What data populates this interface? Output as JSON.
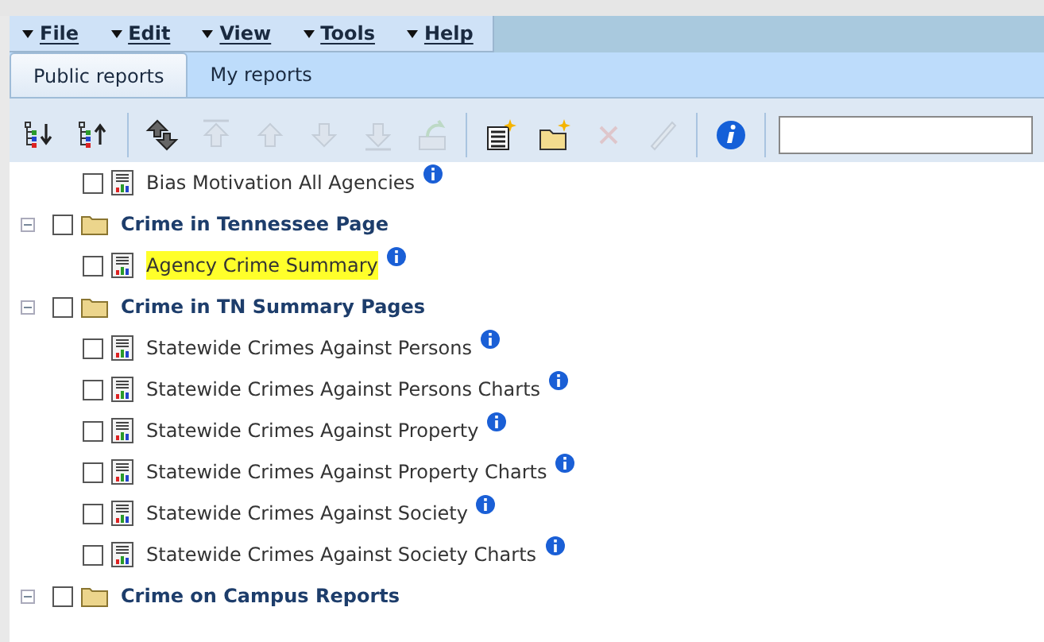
{
  "menu": [
    {
      "label": "File"
    },
    {
      "label": "Edit"
    },
    {
      "label": "View"
    },
    {
      "label": "Tools"
    },
    {
      "label": "Help"
    }
  ],
  "tabs": [
    {
      "label": "Public reports",
      "selected": true
    },
    {
      "label": "My reports",
      "selected": false
    }
  ],
  "toolbar": [
    {
      "kind": "expand-all",
      "disabled": false
    },
    {
      "kind": "collapse-all",
      "disabled": false
    },
    {
      "kind": "sep"
    },
    {
      "kind": "move",
      "disabled": false
    },
    {
      "kind": "top",
      "disabled": true
    },
    {
      "kind": "up",
      "disabled": true
    },
    {
      "kind": "down",
      "disabled": true
    },
    {
      "kind": "bottom",
      "disabled": true
    },
    {
      "kind": "export",
      "disabled": true
    },
    {
      "kind": "sep"
    },
    {
      "kind": "new-report",
      "disabled": false
    },
    {
      "kind": "new-folder",
      "disabled": false
    },
    {
      "kind": "delete",
      "disabled": true
    },
    {
      "kind": "edit",
      "disabled": true
    },
    {
      "kind": "sep"
    },
    {
      "kind": "info",
      "disabled": false
    },
    {
      "kind": "sep"
    }
  ],
  "tree": [
    {
      "label": "Bias Motivation All Agencies",
      "kind": "report",
      "checked": false,
      "highlighted": false
    },
    {
      "label": "Crime in Tennessee Page",
      "kind": "folder",
      "checked": false,
      "expanded": true,
      "children": [
        {
          "label": "Agency Crime Summary",
          "kind": "report",
          "checked": false,
          "highlighted": true
        }
      ]
    },
    {
      "label": "Crime in TN Summary Pages",
      "kind": "folder",
      "checked": false,
      "expanded": true,
      "children": [
        {
          "label": "Statewide Crimes Against Persons",
          "kind": "report",
          "checked": false,
          "highlighted": false
        },
        {
          "label": "Statewide Crimes Against Persons Charts",
          "kind": "report",
          "checked": false,
          "highlighted": false
        },
        {
          "label": "Statewide Crimes Against Property",
          "kind": "report",
          "checked": false,
          "highlighted": false
        },
        {
          "label": "Statewide Crimes Against Property Charts",
          "kind": "report",
          "checked": false,
          "highlighted": false
        },
        {
          "label": "Statewide Crimes Against Society",
          "kind": "report",
          "checked": false,
          "highlighted": false
        },
        {
          "label": "Statewide Crimes Against Society Charts",
          "kind": "report",
          "checked": false,
          "highlighted": false
        }
      ]
    },
    {
      "label": "Crime on Campus Reports",
      "kind": "folder",
      "checked": false,
      "expanded": true
    }
  ]
}
